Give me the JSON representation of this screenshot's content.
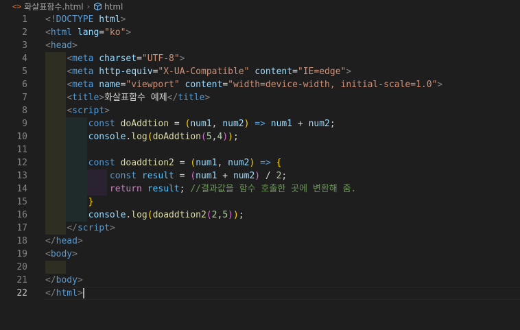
{
  "breadcrumb": {
    "file_icon": "html-file-icon",
    "file_name": "화살표함수.html",
    "separator": "›",
    "symbol_icon": "cube-symbol-icon",
    "symbol_name": "html"
  },
  "editor": {
    "active_line": 22,
    "lines": [
      {
        "n": "1",
        "guides": [],
        "tokens": [
          [
            "<!",
            "punc"
          ],
          [
            "DOCTYPE",
            "tag"
          ],
          [
            " ",
            "text"
          ],
          [
            "html",
            "attr"
          ],
          [
            ">",
            "punc"
          ]
        ]
      },
      {
        "n": "2",
        "guides": [],
        "tokens": [
          [
            "<",
            "punc"
          ],
          [
            "html",
            "tag"
          ],
          [
            " ",
            "text"
          ],
          [
            "lang",
            "attr"
          ],
          [
            "=",
            "text"
          ],
          [
            "\"ko\"",
            "str"
          ],
          [
            ">",
            "punc"
          ]
        ]
      },
      {
        "n": "3",
        "guides": [],
        "tokens": [
          [
            "<",
            "punc"
          ],
          [
            "head",
            "tag"
          ],
          [
            ">",
            "punc"
          ]
        ]
      },
      {
        "n": "4",
        "guides": [
          1
        ],
        "tokens": [
          [
            "    ",
            "text"
          ],
          [
            "<",
            "punc"
          ],
          [
            "meta",
            "tag"
          ],
          [
            " ",
            "text"
          ],
          [
            "charset",
            "attr"
          ],
          [
            "=",
            "text"
          ],
          [
            "\"UTF-8\"",
            "str"
          ],
          [
            ">",
            "punc"
          ]
        ]
      },
      {
        "n": "5",
        "guides": [
          1
        ],
        "tokens": [
          [
            "    ",
            "text"
          ],
          [
            "<",
            "punc"
          ],
          [
            "meta",
            "tag"
          ],
          [
            " ",
            "text"
          ],
          [
            "http-equiv",
            "attr"
          ],
          [
            "=",
            "text"
          ],
          [
            "\"X-UA-Compatible\"",
            "str"
          ],
          [
            " ",
            "text"
          ],
          [
            "content",
            "attr"
          ],
          [
            "=",
            "text"
          ],
          [
            "\"IE=edge\"",
            "str"
          ],
          [
            ">",
            "punc"
          ]
        ]
      },
      {
        "n": "6",
        "guides": [
          1
        ],
        "tokens": [
          [
            "    ",
            "text"
          ],
          [
            "<",
            "punc"
          ],
          [
            "meta",
            "tag"
          ],
          [
            " ",
            "text"
          ],
          [
            "name",
            "attr"
          ],
          [
            "=",
            "text"
          ],
          [
            "\"viewport\"",
            "str"
          ],
          [
            " ",
            "text"
          ],
          [
            "content",
            "attr"
          ],
          [
            "=",
            "text"
          ],
          [
            "\"width=device-width, initial-scale=1.0\"",
            "str"
          ],
          [
            ">",
            "punc"
          ]
        ]
      },
      {
        "n": "7",
        "guides": [
          1
        ],
        "tokens": [
          [
            "    ",
            "text"
          ],
          [
            "<",
            "punc"
          ],
          [
            "title",
            "tag"
          ],
          [
            ">",
            "punc"
          ],
          [
            "화살표함수 예제",
            "text"
          ],
          [
            "</",
            "punc"
          ],
          [
            "title",
            "tag"
          ],
          [
            ">",
            "punc"
          ]
        ]
      },
      {
        "n": "8",
        "guides": [
          1
        ],
        "tokens": [
          [
            "    ",
            "text"
          ],
          [
            "<",
            "punc"
          ],
          [
            "script",
            "tag"
          ],
          [
            ">",
            "punc"
          ]
        ]
      },
      {
        "n": "9",
        "guides": [
          1,
          2
        ],
        "tokens": [
          [
            "        ",
            "text"
          ],
          [
            "const",
            "kw"
          ],
          [
            " ",
            "text"
          ],
          [
            "doAddtion",
            "fn"
          ],
          [
            " = ",
            "op"
          ],
          [
            "(",
            "b1"
          ],
          [
            "num1",
            "var"
          ],
          [
            ", ",
            "op"
          ],
          [
            "num2",
            "var"
          ],
          [
            ")",
            "b1"
          ],
          [
            " ",
            "text"
          ],
          [
            "=>",
            "kw"
          ],
          [
            " ",
            "text"
          ],
          [
            "num1",
            "var"
          ],
          [
            " + ",
            "op"
          ],
          [
            "num2",
            "var"
          ],
          [
            ";",
            "op"
          ]
        ]
      },
      {
        "n": "10",
        "guides": [
          1,
          2
        ],
        "tokens": [
          [
            "        ",
            "text"
          ],
          [
            "console",
            "var"
          ],
          [
            ".",
            "op"
          ],
          [
            "log",
            "fn"
          ],
          [
            "(",
            "b1"
          ],
          [
            "doAddtion",
            "fn"
          ],
          [
            "(",
            "b2"
          ],
          [
            "5",
            "num"
          ],
          [
            ",",
            "op"
          ],
          [
            "4",
            "num"
          ],
          [
            ")",
            "b2"
          ],
          [
            ")",
            "b1"
          ],
          [
            ";",
            "op"
          ]
        ]
      },
      {
        "n": "11",
        "guides": [
          1,
          2
        ],
        "tokens": []
      },
      {
        "n": "12",
        "guides": [
          1,
          2
        ],
        "tokens": [
          [
            "        ",
            "text"
          ],
          [
            "const",
            "kw"
          ],
          [
            " ",
            "text"
          ],
          [
            "doaddtion2",
            "fn"
          ],
          [
            " = ",
            "op"
          ],
          [
            "(",
            "b1"
          ],
          [
            "num1",
            "var"
          ],
          [
            ", ",
            "op"
          ],
          [
            "num2",
            "var"
          ],
          [
            ")",
            "b1"
          ],
          [
            " ",
            "text"
          ],
          [
            "=>",
            "kw"
          ],
          [
            " ",
            "text"
          ],
          [
            "{",
            "b1"
          ]
        ]
      },
      {
        "n": "13",
        "guides": [
          1,
          2,
          3
        ],
        "tokens": [
          [
            "            ",
            "text"
          ],
          [
            "const",
            "kw"
          ],
          [
            " ",
            "text"
          ],
          [
            "result",
            "const"
          ],
          [
            " = ",
            "op"
          ],
          [
            "(",
            "b2"
          ],
          [
            "num1",
            "var"
          ],
          [
            " + ",
            "op"
          ],
          [
            "num2",
            "var"
          ],
          [
            ")",
            "b2"
          ],
          [
            " / ",
            "op"
          ],
          [
            "2",
            "num"
          ],
          [
            ";",
            "op"
          ]
        ]
      },
      {
        "n": "14",
        "guides": [
          1,
          2,
          3
        ],
        "tokens": [
          [
            "            ",
            "text"
          ],
          [
            "return",
            "ctrl"
          ],
          [
            " ",
            "text"
          ],
          [
            "result",
            "const"
          ],
          [
            "; ",
            "op"
          ],
          [
            "//결과값을 함수 호출한 곳에 변환해 줌.",
            "cmt"
          ]
        ]
      },
      {
        "n": "15",
        "guides": [
          1,
          2
        ],
        "tokens": [
          [
            "        ",
            "text"
          ],
          [
            "}",
            "b1"
          ]
        ]
      },
      {
        "n": "16",
        "guides": [
          1,
          2
        ],
        "tokens": [
          [
            "        ",
            "text"
          ],
          [
            "console",
            "var"
          ],
          [
            ".",
            "op"
          ],
          [
            "log",
            "fn"
          ],
          [
            "(",
            "b1"
          ],
          [
            "doaddtion2",
            "fn"
          ],
          [
            "(",
            "b2"
          ],
          [
            "2",
            "num"
          ],
          [
            ",",
            "op"
          ],
          [
            "5",
            "num"
          ],
          [
            ")",
            "b2"
          ],
          [
            ")",
            "b1"
          ],
          [
            ";",
            "op"
          ]
        ]
      },
      {
        "n": "17",
        "guides": [
          1
        ],
        "tokens": [
          [
            "    ",
            "text"
          ],
          [
            "</",
            "punc"
          ],
          [
            "script",
            "tag"
          ],
          [
            ">",
            "punc"
          ]
        ]
      },
      {
        "n": "18",
        "guides": [],
        "tokens": [
          [
            "</",
            "punc"
          ],
          [
            "head",
            "tag"
          ],
          [
            ">",
            "punc"
          ]
        ]
      },
      {
        "n": "19",
        "guides": [],
        "tokens": [
          [
            "<",
            "punc"
          ],
          [
            "body",
            "tag"
          ],
          [
            ">",
            "punc"
          ]
        ]
      },
      {
        "n": "20",
        "guides": [
          1
        ],
        "tokens": []
      },
      {
        "n": "21",
        "guides": [],
        "tokens": [
          [
            "</",
            "punc"
          ],
          [
            "body",
            "tag"
          ],
          [
            ">",
            "punc"
          ]
        ]
      },
      {
        "n": "22",
        "guides": [],
        "tokens": [
          [
            "</",
            "punc"
          ],
          [
            "html",
            "tag"
          ],
          [
            ">",
            "punc"
          ]
        ]
      }
    ]
  },
  "colors": {
    "background": "#1e1e1e",
    "keyword": "#569cd6",
    "string": "#ce9178",
    "attribute": "#9cdcfe",
    "function": "#dcdcaa",
    "comment": "#6a9955",
    "number": "#b5cea8"
  }
}
